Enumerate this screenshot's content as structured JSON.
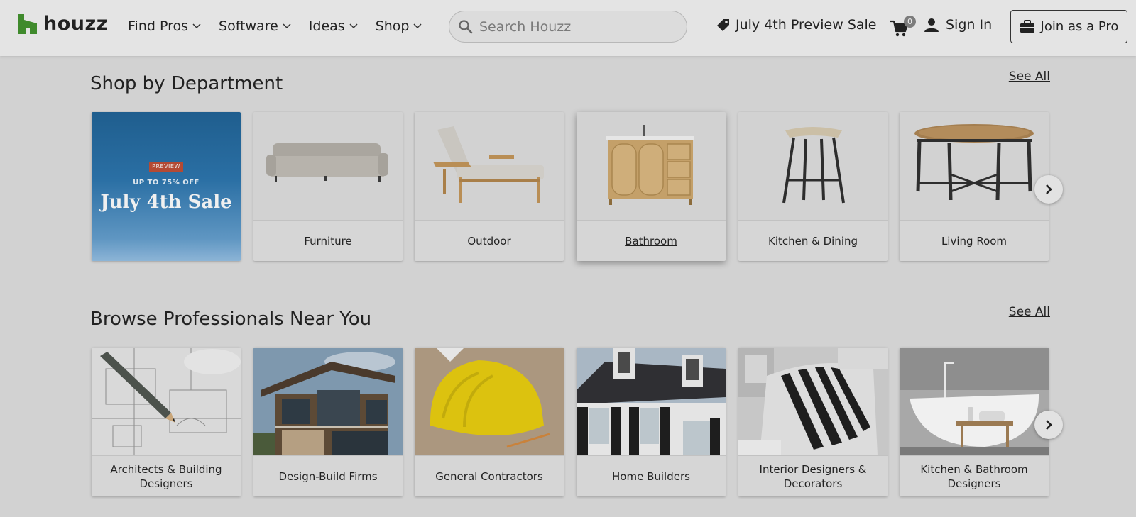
{
  "header": {
    "logo_text": "houzz",
    "nav": [
      {
        "label": "Find Pros"
      },
      {
        "label": "Software"
      },
      {
        "label": "Ideas"
      },
      {
        "label": "Shop"
      }
    ],
    "search_placeholder": "Search Houzz",
    "sale_link": "July 4th Preview Sale",
    "cart_count": "0",
    "sign_in": "Sign In",
    "join_pro": "Join as a Pro"
  },
  "departments": {
    "title": "Shop by Department",
    "see_all": "See All",
    "promo": {
      "tag": "PREVIEW",
      "offer": "UP TO 75% OFF",
      "headline": "July 4th Sale"
    },
    "items": [
      {
        "label": "Furniture",
        "icon": "sofa-image"
      },
      {
        "label": "Outdoor",
        "icon": "chaise-lounge-image"
      },
      {
        "label": "Bathroom",
        "icon": "vanity-image"
      },
      {
        "label": "Kitchen & Dining",
        "icon": "bar-stool-image"
      },
      {
        "label": "Living Room",
        "icon": "coffee-table-image"
      }
    ]
  },
  "professionals": {
    "title": "Browse Professionals Near You",
    "see_all": "See All",
    "items": [
      {
        "label": "Architects & Building Designers",
        "icon": "blueprint-image"
      },
      {
        "label": "Design-Build Firms",
        "icon": "modern-house-image"
      },
      {
        "label": "General Contractors",
        "icon": "hard-hat-image"
      },
      {
        "label": "Home Builders",
        "icon": "colonial-house-image"
      },
      {
        "label": "Interior Designers & Decorators",
        "icon": "striped-chair-image"
      },
      {
        "label": "Kitchen & Bathroom Designers",
        "icon": "bathtub-image"
      }
    ]
  },
  "colors": {
    "brand_green": "#3f8a2c",
    "overlay_gray": "#d2d2d2",
    "promo_blue": "#2a6fa4"
  }
}
